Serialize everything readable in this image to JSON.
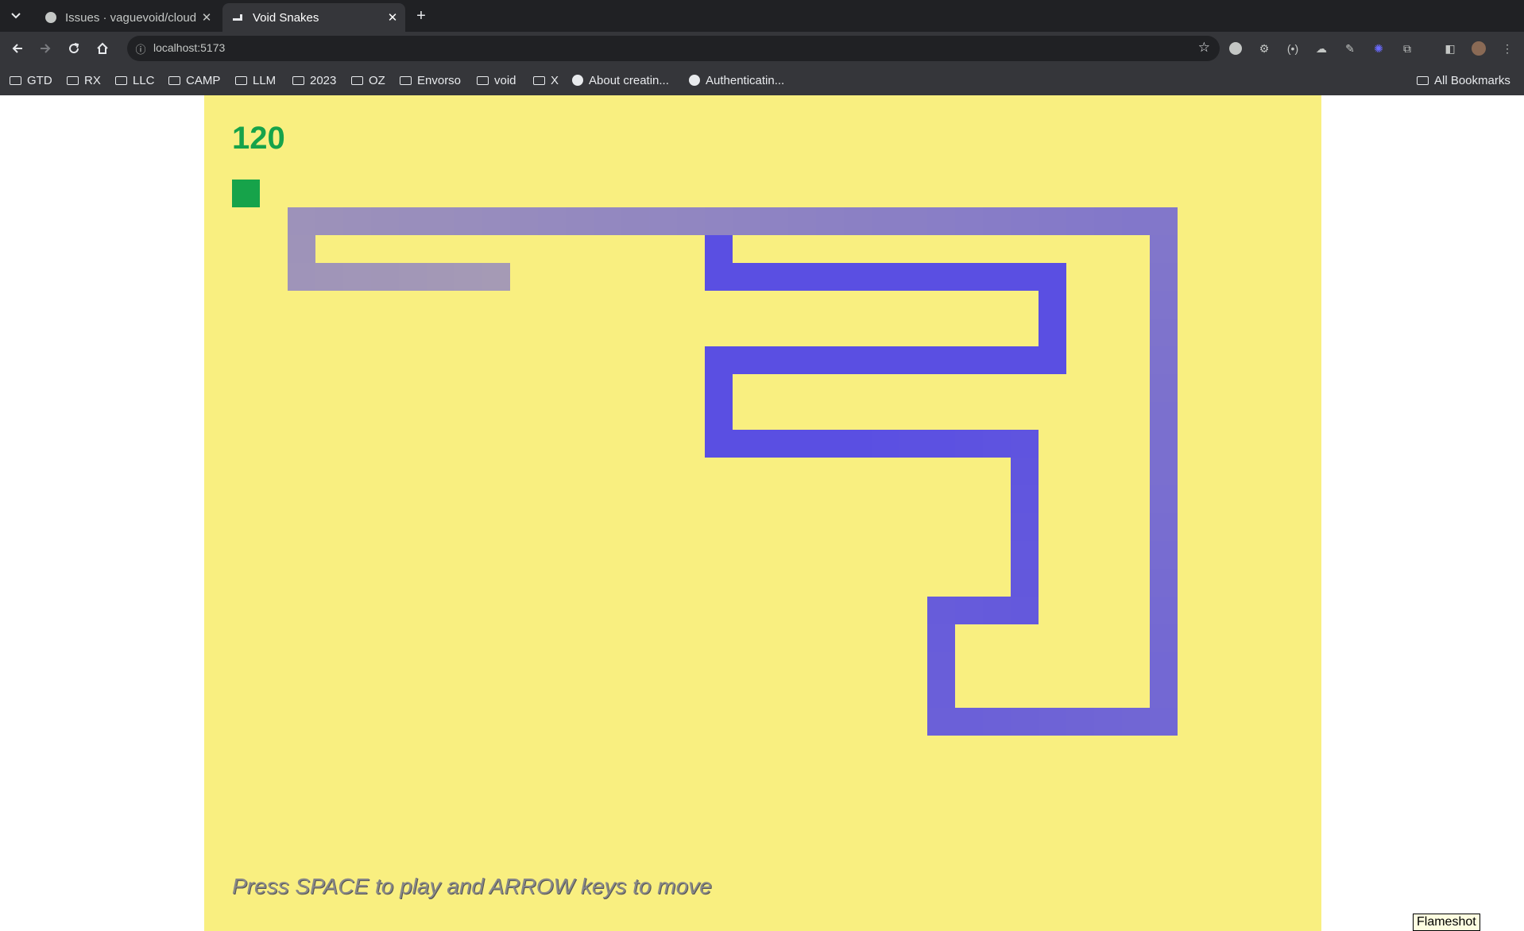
{
  "browser": {
    "tabs": [
      {
        "title": "Issues · vaguevoid/cloud",
        "active": false
      },
      {
        "title": "Void Snakes",
        "active": true
      }
    ],
    "url": "localhost:5173",
    "bookmarks": [
      {
        "label": "GTD",
        "icon": "folder-icon"
      },
      {
        "label": "RX",
        "icon": "folder-icon"
      },
      {
        "label": "LLC",
        "icon": "folder-icon"
      },
      {
        "label": "CAMP",
        "icon": "folder-icon"
      },
      {
        "label": "LLM",
        "icon": "folder-icon"
      },
      {
        "label": "2023",
        "icon": "folder-icon"
      },
      {
        "label": "OZ",
        "icon": "folder-icon"
      },
      {
        "label": "Envorso",
        "icon": "folder-icon"
      },
      {
        "label": "void",
        "icon": "folder-icon"
      },
      {
        "label": "X",
        "icon": "folder-icon"
      },
      {
        "label": "About creatin...",
        "icon": "github-icon"
      },
      {
        "label": "Authenticatin...",
        "icon": "github-icon"
      }
    ],
    "all_bookmarks": "All Bookmarks"
  },
  "game": {
    "score": "120",
    "instructions": "Press SPACE to play and ARROW keys to move",
    "colors": {
      "background": "#f9ef80",
      "score": "#16a34a",
      "food": "#16a34a",
      "snake_head": "#2e2c8e",
      "snake_tail": "#a59ab5",
      "snake_body": "#5a4fe2"
    },
    "grid": {
      "cols": 38,
      "rows": 21
    },
    "food": {
      "col": 0,
      "row": 0
    },
    "snake_path": [
      [
        17,
        1
      ],
      [
        17,
        3
      ],
      [
        29,
        3
      ],
      [
        29,
        6
      ],
      [
        17,
        6
      ],
      [
        17,
        9
      ],
      [
        28,
        9
      ],
      [
        28,
        15
      ],
      [
        25,
        15
      ],
      [
        25,
        19
      ],
      [
        33,
        19
      ],
      [
        33,
        1
      ],
      [
        2,
        1
      ],
      [
        2,
        3
      ],
      [
        9,
        3
      ]
    ]
  },
  "overlay": {
    "label": "Flameshot"
  }
}
